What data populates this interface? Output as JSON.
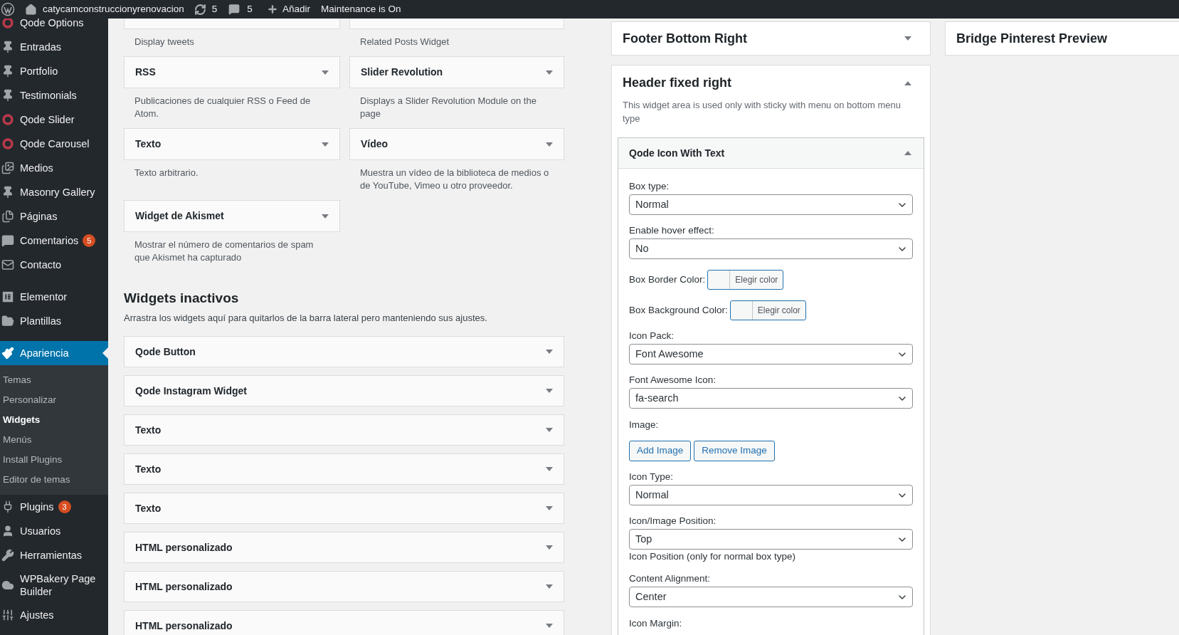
{
  "admin_bar": {
    "site_name": "catycamconstruccionyrenovacion",
    "updates": "5",
    "comments": "5",
    "new_label": "Añadir",
    "maintenance": "Maintenance is On"
  },
  "sidebar": {
    "groups": [
      {
        "items": [
          {
            "label": "Qode Options",
            "selected": false
          },
          {
            "label": "Entradas",
            "selected": false
          },
          {
            "label": "Portfolio",
            "selected": false
          },
          {
            "label": "Testimonials",
            "selected": false
          },
          {
            "label": "Qode Slider",
            "selected": false
          },
          {
            "label": "Qode Carousel",
            "selected": false
          },
          {
            "label": "Medios",
            "selected": false
          },
          {
            "label": "Masonry Gallery",
            "selected": false
          },
          {
            "label": "Páginas",
            "selected": false
          },
          {
            "label": "Comentarios",
            "selected": false,
            "badge": "5"
          },
          {
            "label": "Contacto",
            "selected": false
          }
        ]
      },
      {
        "items": [
          {
            "label": "Elementor",
            "selected": false
          },
          {
            "label": "Plantillas",
            "selected": false
          }
        ]
      },
      {
        "items": [
          {
            "label": "Apariencia",
            "selected": true,
            "children": [
              {
                "label": "Temas",
                "selected": false
              },
              {
                "label": "Personalizar",
                "selected": false
              },
              {
                "label": "Widgets",
                "selected": true
              },
              {
                "label": "Menús",
                "selected": false
              },
              {
                "label": "Install Plugins",
                "selected": false
              },
              {
                "label": "Editor de temas",
                "selected": false
              }
            ]
          },
          {
            "label": "Plugins",
            "selected": false,
            "badge": "3"
          },
          {
            "label": "Usuarios",
            "selected": false
          },
          {
            "label": "Herramientas",
            "selected": false
          },
          {
            "label": "WPBakery Page Builder",
            "selected": false
          },
          {
            "label": "Ajustes",
            "selected": false
          }
        ]
      }
    ]
  },
  "available_widgets": [
    {
      "description": "Display tweets"
    },
    {
      "description": "Related Posts Widget"
    },
    {
      "title": "RSS",
      "description": "Publicaciones de cualquier RSS o Feed de Atom."
    },
    {
      "title": "Slider Revolution",
      "description": "Displays a Slider Revolution Module on the page"
    },
    {
      "title": "Texto",
      "description": "Texto arbitrario."
    },
    {
      "title": "Vídeo",
      "description": "Muestra un vídeo de la biblioteca de medios o de YouTube, Vimeo u otro proveedor."
    },
    {
      "title": "Widget de Akismet",
      "description": "Mostrar el número de comentarios de spam que Akismet ha capturado"
    }
  ],
  "inactive_widgets": {
    "heading": "Widgets inactivos",
    "description": "Arrastra los widgets aquí para quitarlos de la barra lateral pero manteniendo sus ajustes.",
    "widgets": [
      "Qode Button",
      "Qode Instagram Widget",
      "Texto",
      "Texto",
      "Texto",
      "HTML personalizado",
      "HTML personalizado",
      "HTML personalizado"
    ]
  },
  "sidebars": [
    {
      "title": "Footer Bottom Right",
      "expanded": false
    },
    {
      "title": "Header fixed right",
      "expanded": true,
      "description": "This widget area is used only with sticky with menu on bottom menu type",
      "widgets": [
        {
          "title": "Qode Icon With Text",
          "expanded": true,
          "fields": [
            {
              "kind": "select",
              "label": "Box type:",
              "value": "Normal"
            },
            {
              "kind": "select",
              "label": "Enable hover effect:",
              "value": "No"
            },
            {
              "kind": "color",
              "label": "Box Border Color:",
              "button": "Elegir color"
            },
            {
              "kind": "color",
              "label": "Box Background Color:",
              "button": "Elegir color"
            },
            {
              "kind": "select",
              "label": "Icon Pack:",
              "value": "Font Awesome"
            },
            {
              "kind": "select",
              "label": "Font Awesome Icon:",
              "value": "fa-search"
            },
            {
              "kind": "image",
              "label": "Image:",
              "buttons": [
                "Add Image",
                "Remove Image"
              ]
            },
            {
              "kind": "select",
              "label": "Icon Type:",
              "value": "Normal"
            },
            {
              "kind": "select",
              "label": "Icon/Image Position:",
              "value": "Top",
              "hint": "Icon Position (only for normal box type)"
            },
            {
              "kind": "select",
              "label": "Content Alignment:",
              "value": "Center"
            },
            {
              "kind": "label",
              "label": "Icon Margin:"
            }
          ]
        }
      ]
    }
  ],
  "third_column": {
    "title": "Bridge Pinterest Preview"
  }
}
